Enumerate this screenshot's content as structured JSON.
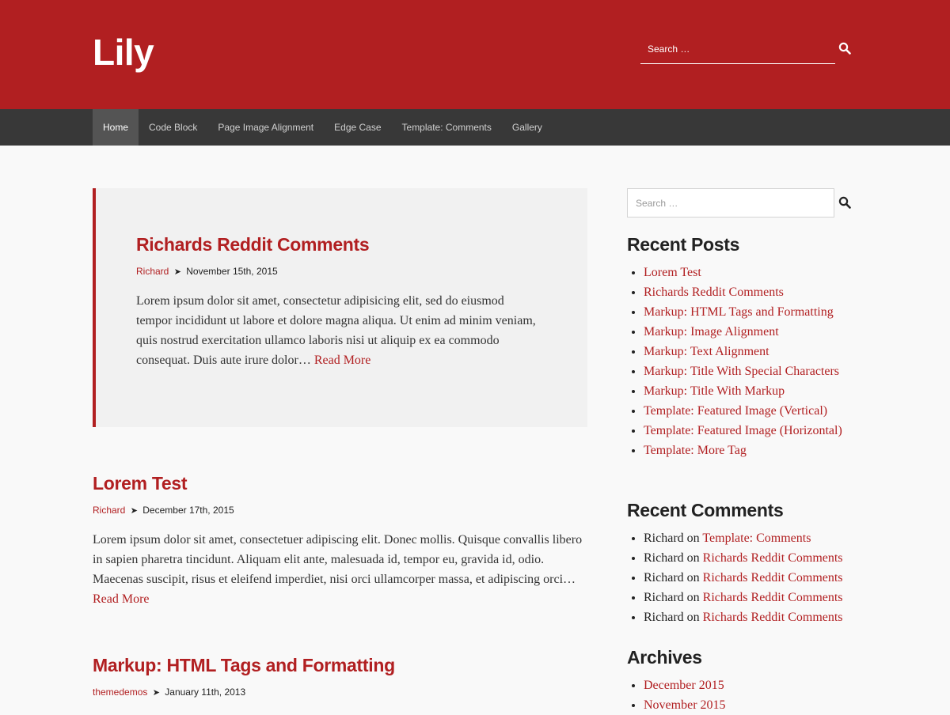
{
  "site": {
    "title": "Lily"
  },
  "header_search": {
    "placeholder": "Search …"
  },
  "nav": {
    "items": [
      {
        "label": "Home"
      },
      {
        "label": "Code Block"
      },
      {
        "label": "Page Image Alignment"
      },
      {
        "label": "Edge Case"
      },
      {
        "label": "Template: Comments"
      },
      {
        "label": "Gallery"
      }
    ]
  },
  "posts": [
    {
      "title": "Richards Reddit Comments",
      "author": "Richard",
      "separator": "➤",
      "date": "November 15th, 2015",
      "excerpt": "Lorem ipsum dolor sit amet, consectetur adipisicing elit, sed do eiusmod tempor incididunt ut labore et dolore magna aliqua. Ut enim ad minim veniam, quis nostrud exercitation ullamco laboris nisi ut aliquip ex ea commodo consequat. Duis aute irure dolor…",
      "more": "Read More"
    },
    {
      "title": "Lorem Test",
      "author": "Richard",
      "separator": "➤",
      "date": "December 17th, 2015",
      "excerpt": "Lorem ipsum dolor sit amet, consectetuer adipiscing elit. Donec mollis. Quisque convallis libero in sapien pharetra tincidunt. Aliquam elit ante, malesuada id, tempor eu, gravida id, odio. Maecenas suscipit, risus et eleifend imperdiet, nisi orci ullamcorper massa, et adipiscing orci…",
      "more": "Read More"
    },
    {
      "title": "Markup: HTML Tags and Formatting",
      "author": "themedemos",
      "separator": "➤",
      "date": "January 11th, 2013"
    }
  ],
  "sidebar": {
    "search_placeholder": "Search …",
    "recent_posts": {
      "title": "Recent Posts",
      "items": [
        "Lorem Test",
        "Richards Reddit Comments",
        "Markup: HTML Tags and Formatting",
        "Markup: Image Alignment",
        "Markup: Text Alignment",
        "Markup: Title With Special Characters",
        "Markup: Title With Markup",
        "Template: Featured Image (Vertical)",
        "Template: Featured Image (Horizontal)",
        "Template: More Tag"
      ]
    },
    "recent_comments": {
      "title": "Recent Comments",
      "items": [
        {
          "author": "Richard",
          "on": "on",
          "post": "Template: Comments"
        },
        {
          "author": "Richard",
          "on": "on",
          "post": "Richards Reddit Comments"
        },
        {
          "author": "Richard",
          "on": "on",
          "post": "Richards Reddit Comments"
        },
        {
          "author": "Richard",
          "on": "on",
          "post": "Richards Reddit Comments"
        },
        {
          "author": "Richard",
          "on": "on",
          "post": "Richards Reddit Comments"
        }
      ]
    },
    "archives": {
      "title": "Archives",
      "items": [
        "December 2015",
        "November 2015"
      ]
    }
  },
  "colors": {
    "brand": "#b11f21",
    "nav_bg": "#383838",
    "nav_active": "#545454"
  },
  "icons": {
    "search": "search-icon"
  }
}
